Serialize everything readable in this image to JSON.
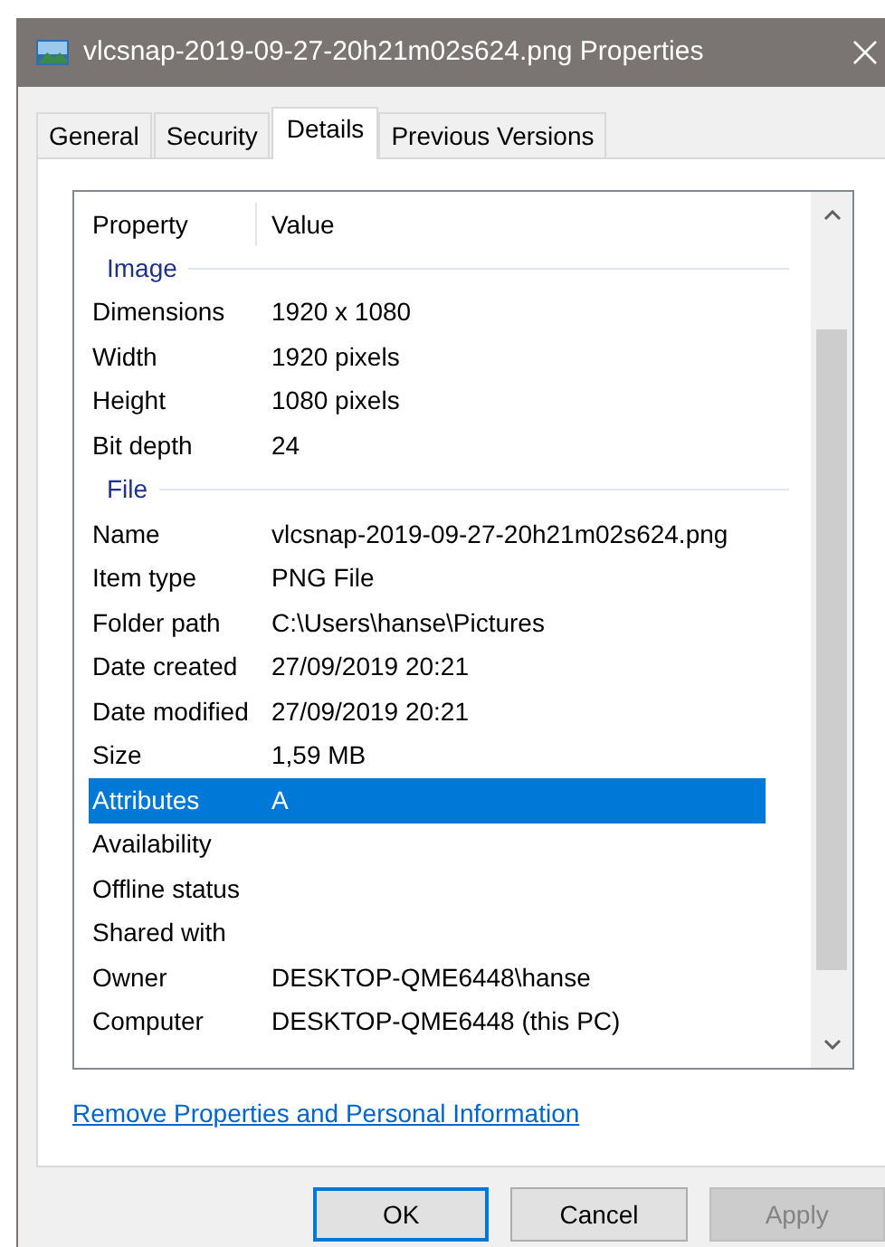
{
  "window": {
    "title": "vlcsnap-2019-09-27-20h21m02s624.png Properties"
  },
  "tabs": [
    {
      "label": "General",
      "selected": false
    },
    {
      "label": "Security",
      "selected": false
    },
    {
      "label": "Details",
      "selected": true
    },
    {
      "label": "Previous Versions",
      "selected": false
    }
  ],
  "list": {
    "columns": [
      "Property",
      "Value"
    ],
    "groups": [
      {
        "label": "Image",
        "rows": [
          {
            "property": "Dimensions",
            "value": "1920 x 1080",
            "selected": false
          },
          {
            "property": "Width",
            "value": "1920 pixels",
            "selected": false
          },
          {
            "property": "Height",
            "value": "1080 pixels",
            "selected": false
          },
          {
            "property": "Bit depth",
            "value": "24",
            "selected": false
          }
        ]
      },
      {
        "label": "File",
        "rows": [
          {
            "property": "Name",
            "value": "vlcsnap-2019-09-27-20h21m02s624.png",
            "selected": false
          },
          {
            "property": "Item type",
            "value": "PNG File",
            "selected": false
          },
          {
            "property": "Folder path",
            "value": "C:\\Users\\hanse\\Pictures",
            "selected": false
          },
          {
            "property": "Date created",
            "value": "27/09/2019 20:21",
            "selected": false
          },
          {
            "property": "Date modified",
            "value": "27/09/2019 20:21",
            "selected": false
          },
          {
            "property": "Size",
            "value": "1,59 MB",
            "selected": false
          },
          {
            "property": "Attributes",
            "value": "A",
            "selected": true
          },
          {
            "property": "Availability",
            "selected": false
          },
          {
            "property": "Offline status",
            "selected": false
          },
          {
            "property": "Shared with",
            "selected": false
          },
          {
            "property": "Owner",
            "value": "DESKTOP-QME6448\\hanse",
            "selected": false
          },
          {
            "property": "Computer",
            "value": "DESKTOP-QME6448 (this PC)",
            "selected": false
          }
        ]
      }
    ]
  },
  "link": "Remove Properties and Personal Information",
  "buttons": [
    {
      "label": "OK",
      "default": true,
      "disabled": false
    },
    {
      "label": "Cancel",
      "default": false,
      "disabled": false
    },
    {
      "label": "Apply",
      "default": false,
      "disabled": true
    }
  ]
}
